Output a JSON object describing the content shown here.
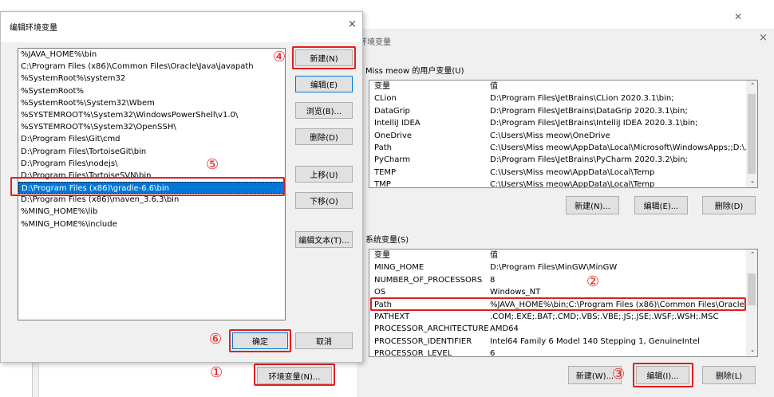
{
  "edit_dialog": {
    "title": "编辑环境变量",
    "close": "×",
    "items": [
      "%JAVA_HOME%\\bin",
      "C:\\Program Files (x86)\\Common Files\\Oracle\\Java\\javapath",
      "%SystemRoot%\\system32",
      "%SystemRoot%",
      "%SystemRoot%\\System32\\Wbem",
      "%SYSTEMROOT%\\System32\\WindowsPowerShell\\v1.0\\",
      "%SYSTEMROOT%\\System32\\OpenSSH\\",
      "D:\\Program Files\\Git\\cmd",
      "D:\\Program Files\\TortoiseGit\\bin",
      "D:\\Program Files\\nodejs\\",
      "D:\\Program Files\\TortoiseSVN\\bin",
      "D:\\Program Files (x86)\\gradle-6.6\\bin",
      "D:\\Program Files (x86)\\maven_3.6.3\\bin",
      "%MING_HOME%\\lib",
      "%MING_HOME%\\include"
    ],
    "selected_index": 11,
    "buttons": {
      "new": "新建(N)",
      "edit": "编辑(E)",
      "browse": "浏览(B)...",
      "delete": "删除(D)",
      "up": "上移(U)",
      "down": "下移(O)",
      "edit_text": "编辑文本(T)...",
      "ok": "确定",
      "cancel": "取消"
    }
  },
  "env_dialog": {
    "title": "环境变量",
    "close": "×",
    "top_close": "✕",
    "user_section": "Miss meow 的用户变量(U)",
    "headers": {
      "var": "变量",
      "value": "值"
    },
    "user_vars": [
      {
        "name": "CLion",
        "value": "D:\\Program Files\\JetBrains\\CLion 2020.3.1\\bin;"
      },
      {
        "name": "DataGrip",
        "value": "D:\\Program Files\\JetBrains\\DataGrip 2020.3.1\\bin;"
      },
      {
        "name": "IntelliJ IDEA",
        "value": "D:\\Program Files\\JetBrains\\IntelliJ IDEA 2020.3.1\\bin;"
      },
      {
        "name": "OneDrive",
        "value": "C:\\Users\\Miss meow\\OneDrive"
      },
      {
        "name": "Path",
        "value": "C:\\Users\\Miss meow\\AppData\\Local\\Microsoft\\WindowsApps;;D:\\..."
      },
      {
        "name": "PyCharm",
        "value": "D:\\Program Files\\JetBrains\\PyCharm 2020.3.2\\bin;"
      },
      {
        "name": "TEMP",
        "value": "C:\\Users\\Miss meow\\AppData\\Local\\Temp"
      },
      {
        "name": "TMP",
        "value": "C:\\Users\\Miss meow\\AppData\\Local\\Temp"
      }
    ],
    "user_buttons": {
      "new": "新建(N)...",
      "edit": "编辑(E)...",
      "delete": "删除(D)"
    },
    "sys_section": "系统变量(S)",
    "sys_vars": [
      {
        "name": "MING_HOME",
        "value": "D:\\Program Files\\MinGW\\MinGW"
      },
      {
        "name": "NUMBER_OF_PROCESSORS",
        "value": "8"
      },
      {
        "name": "OS",
        "value": "Windows_NT"
      },
      {
        "name": "Path",
        "value": "%JAVA_HOME%\\bin;C:\\Program Files (x86)\\Common Files\\Oracle\\..."
      },
      {
        "name": "PATHEXT",
        "value": ".COM;.EXE;.BAT;.CMD;.VBS;.VBE;.JS;.JSE;.WSF;.WSH;.MSC"
      },
      {
        "name": "PROCESSOR_ARCHITECTURE",
        "value": "AMD64"
      },
      {
        "name": "PROCESSOR_IDENTIFIER",
        "value": "Intel64 Family 6 Model 140 Stepping 1, GenuineIntel"
      },
      {
        "name": "PROCESSOR_LEVEL",
        "value": "6"
      }
    ],
    "sys_buttons": {
      "new": "新建(W)...",
      "edit": "编辑(I)...",
      "delete": "删除(L)"
    }
  },
  "bg_button": "环境变量(N)...",
  "markers": {
    "m1": "①",
    "m2": "②",
    "m3": "③",
    "m4": "④",
    "m5": "⑤",
    "m6": "⑥"
  }
}
